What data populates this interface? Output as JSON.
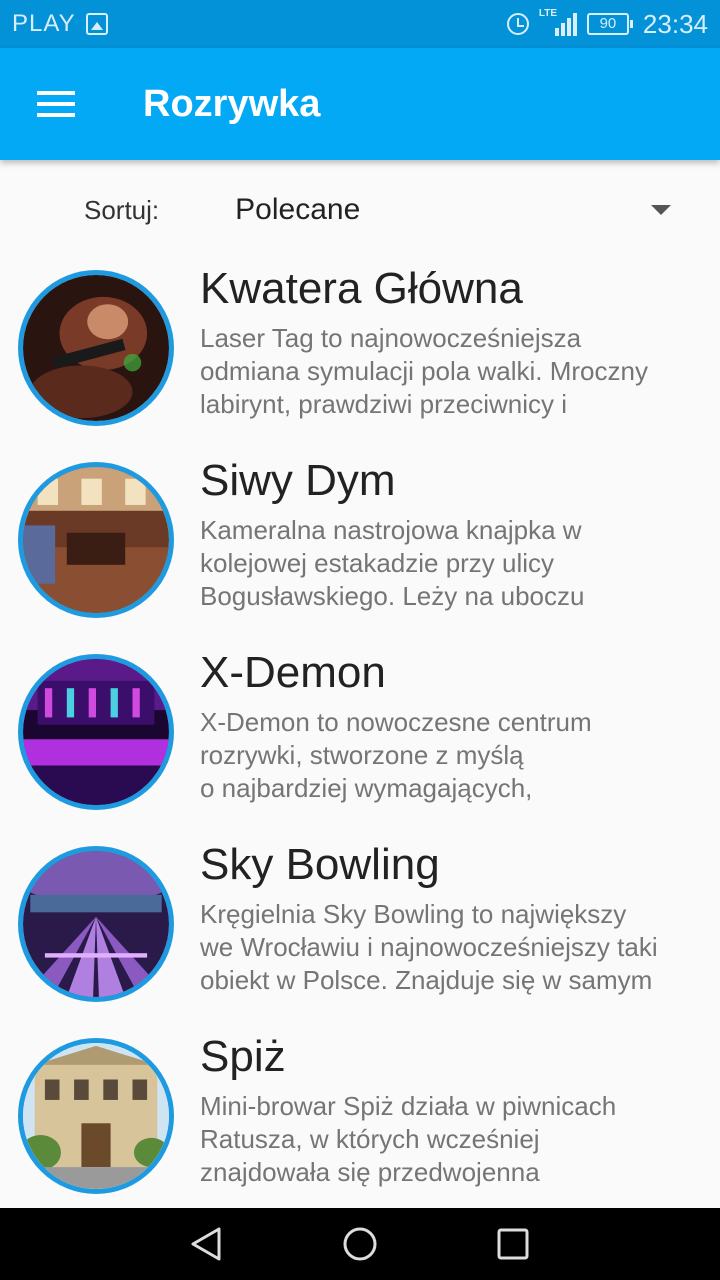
{
  "status_bar": {
    "carrier": "PLAY",
    "network": "LTE",
    "battery": "90",
    "time": "23:34"
  },
  "app_bar": {
    "title": "Rozrywka"
  },
  "sort": {
    "label": "Sortuj:",
    "selected": "Polecane"
  },
  "items": [
    {
      "title": "Kwatera Główna",
      "description": "Laser Tag to najnowocześniejsza\nodmiana symulacji pola walki. Mroczny\nlabirynt, prawdziwi przeciwnicy i"
    },
    {
      "title": "Siwy Dym",
      "description": "Kameralna nastrojowa knajpka w\nkolejowej estakadzie przy ulicy\nBogusławskiego. Leży na uboczu"
    },
    {
      "title": "X-Demon",
      "description": "X-Demon to nowoczesne centrum\nrozrywki, stworzone z myślą\no najbardziej wymagających,"
    },
    {
      "title": "Sky Bowling",
      "description": "Kręgielnia Sky Bowling to największy\nwe Wrocławiu i najnowocześniejszy taki\nobiekt w Polsce. Znajduje się w samym"
    },
    {
      "title": "Spiż",
      "description": "Mini-browar Spiż działa w piwnicach\nRatusza, w których wcześniej\nznajdowała się przedwojenna"
    }
  ],
  "colors": {
    "status_bar": "#0391d8",
    "app_bar": "#03a9f4",
    "thumb_ring": "#1e9be0"
  }
}
